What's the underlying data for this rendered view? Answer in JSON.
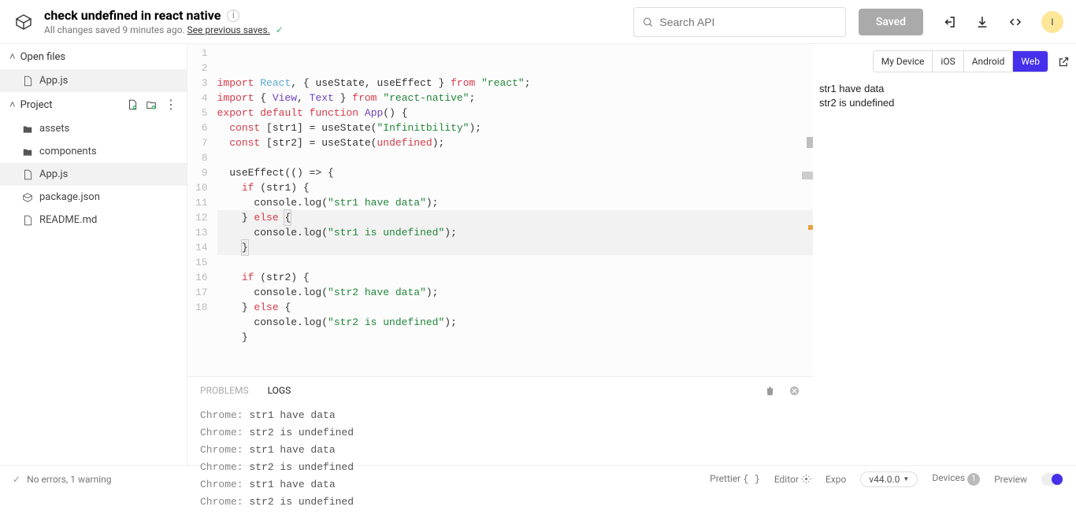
{
  "header": {
    "title": "check undefined in react native",
    "subtitle_prefix": "All changes saved 9 minutes ago. ",
    "subtitle_link": "See previous saves.",
    "search_placeholder": "Search API",
    "saved_button": "Saved",
    "avatar_initial": "I"
  },
  "sidebar": {
    "open_files_label": "Open files",
    "open_files": [
      {
        "name": "App.js",
        "active": true
      }
    ],
    "project_label": "Project",
    "project_files": [
      {
        "name": "assets",
        "icon": "folder"
      },
      {
        "name": "components",
        "icon": "folder"
      },
      {
        "name": "App.js",
        "icon": "js",
        "active": true
      },
      {
        "name": "package.json",
        "icon": "pkg"
      },
      {
        "name": "README.md",
        "icon": "md"
      }
    ]
  },
  "editor": {
    "line_start": 1,
    "line_end": 18
  },
  "panel": {
    "tabs": [
      "PROBLEMS",
      "LOGS"
    ],
    "active_tab": "LOGS",
    "logs": [
      {
        "src": "Chrome:",
        "msg": "str1 have data"
      },
      {
        "src": "Chrome:",
        "msg": "str2 is undefined"
      },
      {
        "src": "Chrome:",
        "msg": "str1 have data"
      },
      {
        "src": "Chrome:",
        "msg": "str2 is undefined"
      },
      {
        "src": "Chrome:",
        "msg": "str1 have data"
      },
      {
        "src": "Chrome:",
        "msg": "str2 is undefined"
      }
    ]
  },
  "preview": {
    "tabs": [
      "My Device",
      "iOS",
      "Android",
      "Web"
    ],
    "active_tab": "Web",
    "output": [
      "str1 have data",
      "str2 is undefined"
    ]
  },
  "bottom_bar": {
    "status": "No errors, 1 warning",
    "prettier": "Prettier",
    "editor": "Editor",
    "expo": "Expo",
    "expo_version": "v44.0.0",
    "devices": "Devices",
    "devices_count": "1",
    "preview_label": "Preview"
  }
}
